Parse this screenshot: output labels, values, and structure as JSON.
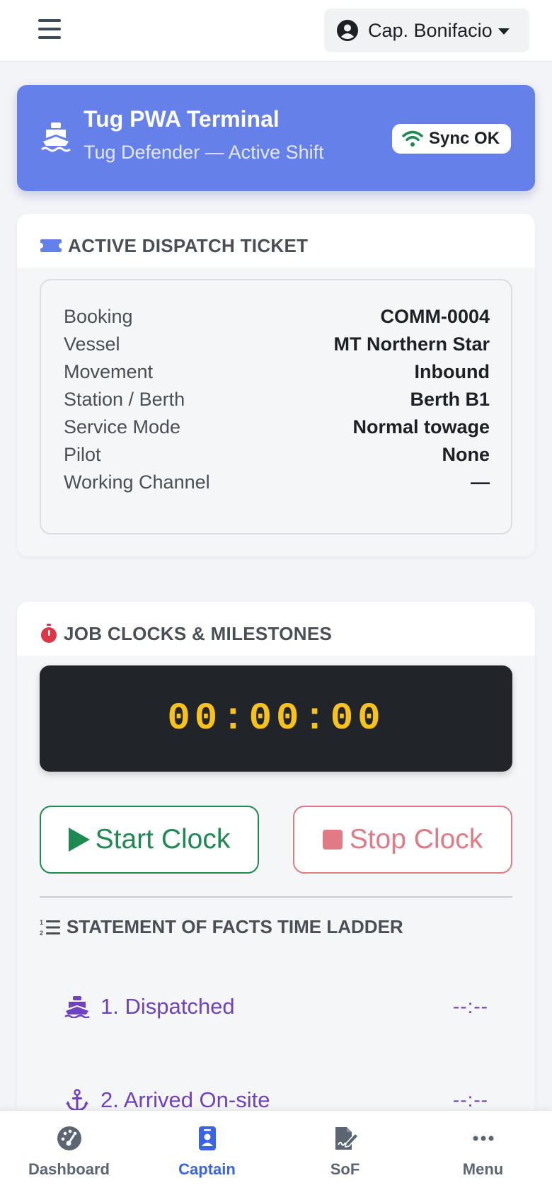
{
  "header": {
    "user_name": "Cap. Bonifacio",
    "menu_icon": "hamburger-icon",
    "user_icon": "user-circle-icon"
  },
  "hero": {
    "title": "Tug PWA Terminal",
    "subtitle": "Tug Defender — Active Shift",
    "sync_label": "Sync OK",
    "accent_color": "#6680ea",
    "icon": "ship-icon"
  },
  "ticket": {
    "heading": "ACTIVE DISPATCH TICKET",
    "rows": [
      {
        "label": "Booking",
        "value": "COMM-0004"
      },
      {
        "label": "Vessel",
        "value": "MT Northern Star"
      },
      {
        "label": "Movement",
        "value": "Inbound"
      },
      {
        "label": "Station / Berth",
        "value": "Berth B1"
      },
      {
        "label": "Service Mode",
        "value": "Normal towage"
      },
      {
        "label": "Pilot",
        "value": "None"
      },
      {
        "label": "Working Channel",
        "value": "—"
      }
    ]
  },
  "clock": {
    "heading": "JOB CLOCKS & MILESTONES",
    "display": "00:00:00",
    "start_label": "Start Clock",
    "stop_label": "Stop Clock",
    "display_color": "#f8c21c"
  },
  "sof": {
    "heading": "STATEMENT OF FACTS TIME LADDER",
    "items": [
      {
        "label": "1. Dispatched",
        "time": "--:--",
        "icon": "ship-icon"
      },
      {
        "label": "2. Arrived On-site",
        "time": "--:--",
        "icon": "anchor-icon"
      }
    ]
  },
  "nav": {
    "items": [
      {
        "label": "Dashboard",
        "icon": "gauge-icon"
      },
      {
        "label": "Captain",
        "icon": "id-badge-icon"
      },
      {
        "label": "SoF",
        "icon": "file-signature-icon"
      },
      {
        "label": "Menu",
        "icon": "ellipsis-icon"
      }
    ],
    "active": "Captain",
    "active_color": "#3a63e6"
  }
}
